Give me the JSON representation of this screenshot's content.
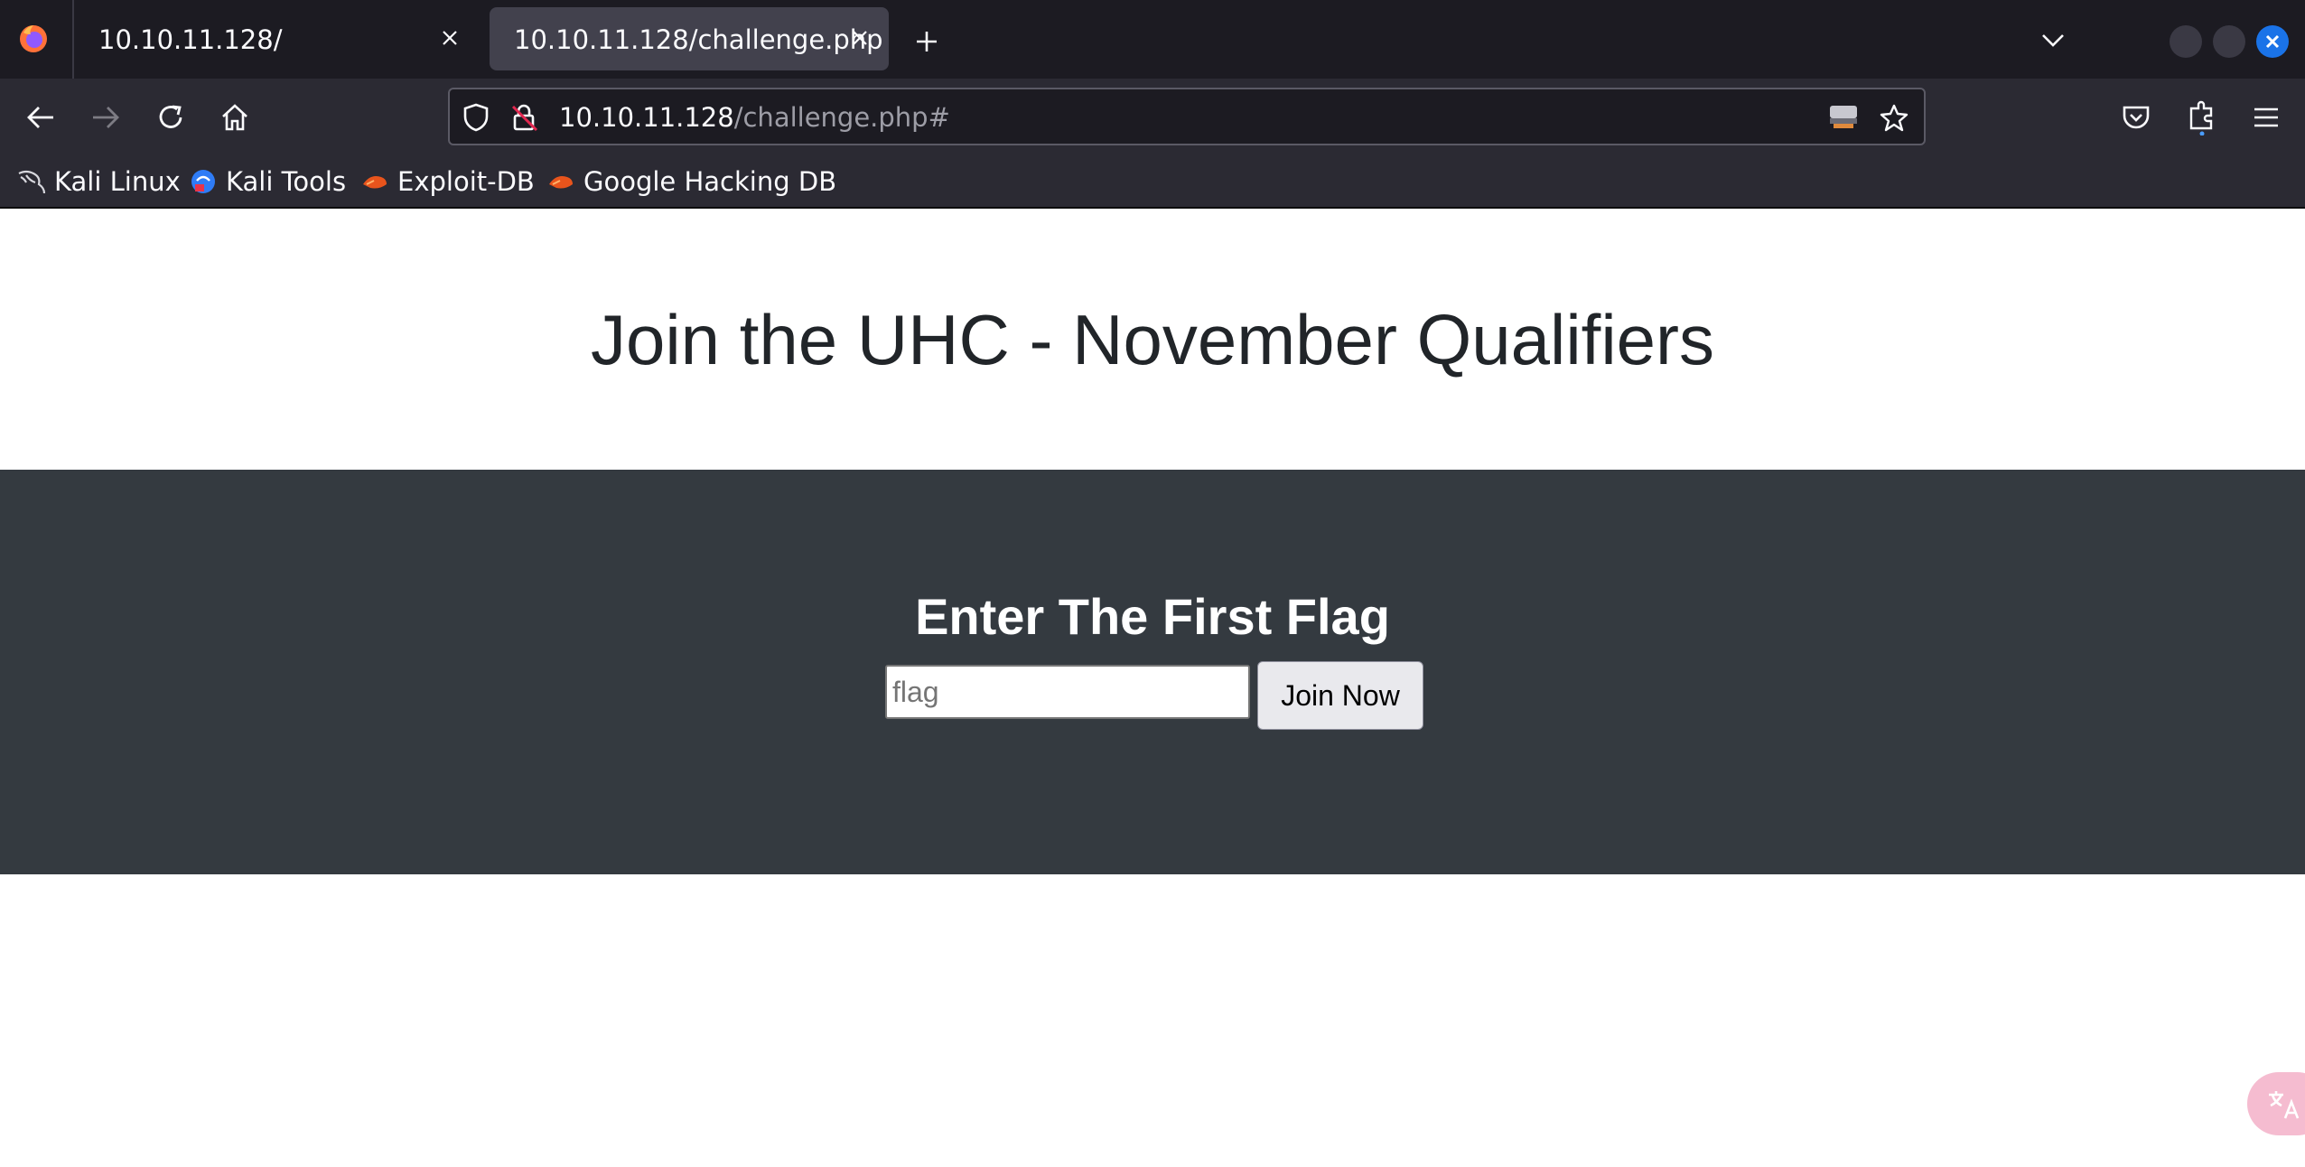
{
  "browser": {
    "tabs": [
      {
        "title": "10.10.11.128/",
        "active": false
      },
      {
        "title": "10.10.11.128/challenge.php",
        "active": true
      }
    ],
    "url": {
      "host": "10.10.11.128",
      "path": "/challenge.php#"
    },
    "bookmarks": [
      {
        "label": "Kali Linux",
        "icon": "kali-dragon-icon"
      },
      {
        "label": "Kali Tools",
        "icon": "kali-tools-icon"
      },
      {
        "label": "Exploit-DB",
        "icon": "exploit-db-icon"
      },
      {
        "label": "Google Hacking DB",
        "icon": "ghdb-icon"
      }
    ],
    "accent": "#1a73e8"
  },
  "page": {
    "title": "Join the UHC - November Qualifiers",
    "form": {
      "heading": "Enter The First Flag",
      "flag_placeholder": "flag",
      "flag_value": "",
      "submit_label": "Join Now"
    },
    "band_color": "#343a40"
  }
}
